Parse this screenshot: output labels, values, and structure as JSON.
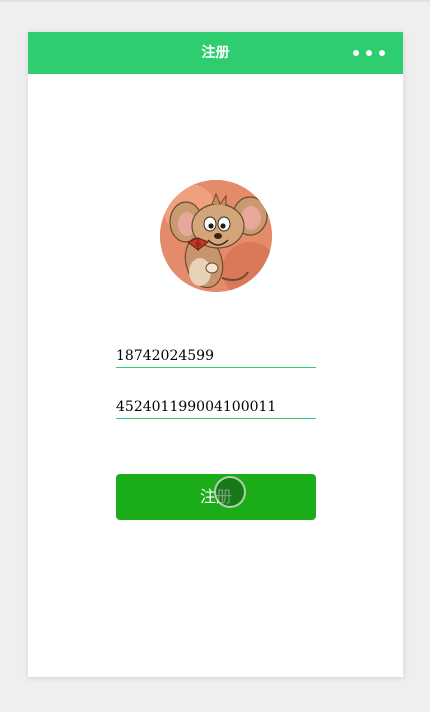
{
  "nav": {
    "title": "注册",
    "more_icon": "more-dots-icon"
  },
  "avatar": {
    "icon": "cartoon-mouse-avatar"
  },
  "form": {
    "phone_value": "18742024599",
    "id_value": "452401199004100011",
    "submit_label": "注册"
  },
  "colors": {
    "nav_bg": "#2ecd6f",
    "button_bg": "#1aad19",
    "field_underline": "#2ecd6f",
    "page_bg": "#efefef"
  }
}
